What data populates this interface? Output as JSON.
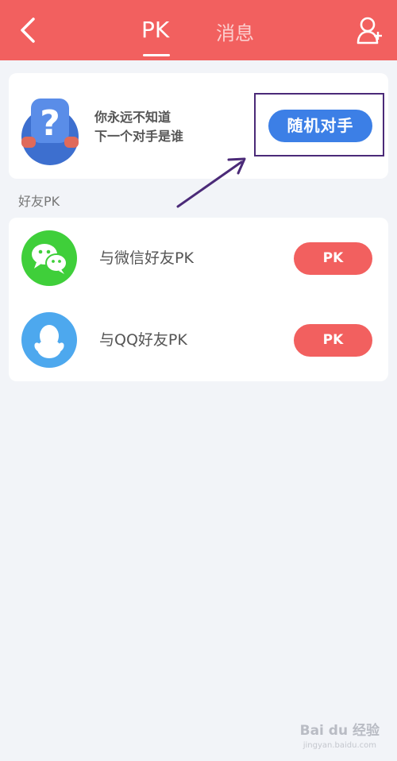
{
  "header": {
    "tabs": [
      {
        "label": "PK",
        "active": true
      },
      {
        "label": "消息",
        "active": false
      }
    ],
    "background_color": "#f2605f",
    "left_icon": "back-icon",
    "right_icon": "add-friend-icon"
  },
  "random_match": {
    "slogan_line1": "你永远不知道",
    "slogan_line2": "下一个对手是谁",
    "button_label": "随机对手",
    "button_color": "#3c7fe6",
    "mascot_icon": "question-mark-mascot-icon"
  },
  "friends_section": {
    "title": "好友PK",
    "items": [
      {
        "label": "与微信好友PK",
        "icon": "wechat-icon",
        "button_label": "PK"
      },
      {
        "label": "与QQ好友PK",
        "icon": "qq-icon",
        "button_label": "PK"
      }
    ]
  },
  "watermark": {
    "text": "Bai du 经验",
    "sub": "jingyan.baidu.com"
  }
}
